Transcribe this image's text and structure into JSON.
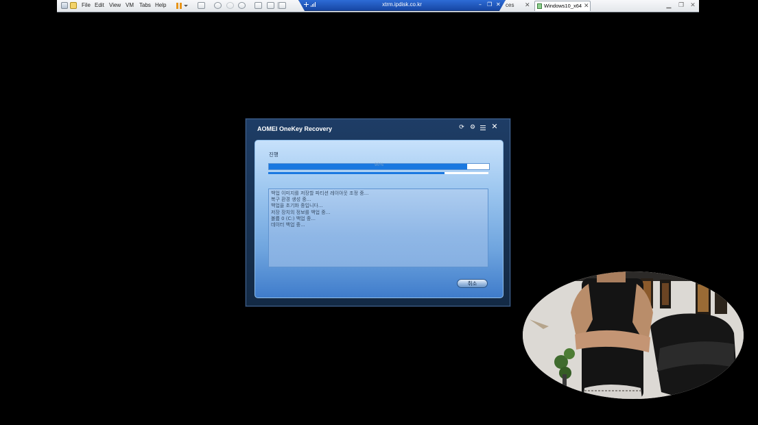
{
  "vmware": {
    "menu": [
      "File",
      "Edit",
      "View",
      "VM",
      "Tabs",
      "Help"
    ],
    "remote_host": "xtrm.ipdisk.co.kr",
    "hidden_tab_fragment": "ces",
    "active_tab": "Windows10_x64",
    "icons": [
      "vmware-logo-icon",
      "library-icon",
      "pause-icon",
      "snapshot-icon",
      "fullscreen-icon"
    ]
  },
  "dialog": {
    "title": "AOMEI OneKey Recovery",
    "section": "진행",
    "progress_text": "90%",
    "progress": 0.9,
    "sub_progress": 0.8,
    "log": [
      "백업 이미지를 저장할 파티션 레이아웃 조정 중...",
      "복구 환경 생성 중...",
      "백업을 초기화 중입니다...",
      "저장 장치의 정보를 백업 중...",
      "볼륨 0 (C:) 백업 중...",
      "데이터 백업 중..."
    ],
    "cancel_label": "취소",
    "colors": {
      "accent": "#1a78e0",
      "title_bar": "#1e3d66"
    }
  }
}
